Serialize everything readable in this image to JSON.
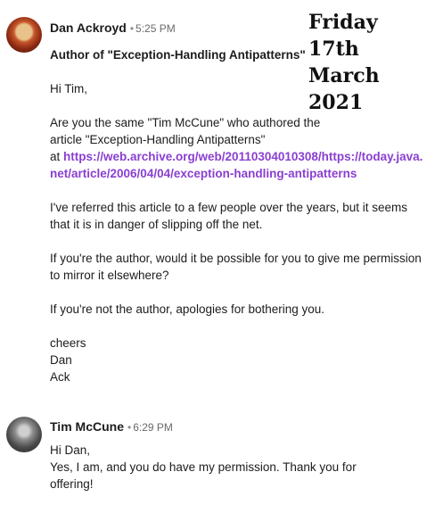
{
  "date_overlay": "Friday 17th March 2021",
  "messages": [
    {
      "author": "Dan Ackroyd",
      "separator": "•",
      "time": "5:25 PM",
      "subject": "Author of \"Exception-Handling Antipatterns\"",
      "greeting": "Hi Tim,",
      "para1_line1": "Are you the same \"Tim McCune\" who authored the",
      "para1_line2": "article \"Exception-Handling Antipatterns\"",
      "para1_at": "at ",
      "link": "https://web.archive.org/web/20110304010308/https://today.java.net/article/2006/04/04/exception-handling-antipatterns",
      "para2": "I've referred this article to a few people over the years, but it seems that it is in danger of slipping off the net.",
      "para3": "If you're the author, would it be possible for you to give me permission to mirror it elsewhere?",
      "para4": "If you're not the author, apologies for bothering you.",
      "signoff": [
        "cheers",
        "Dan",
        "Ack"
      ]
    },
    {
      "author": "Tim McCune",
      "separator": "•",
      "time": "6:29 PM",
      "greeting": "Hi Dan,",
      "reply": "Yes, I am, and you do have my permission. Thank you for offering!"
    }
  ]
}
